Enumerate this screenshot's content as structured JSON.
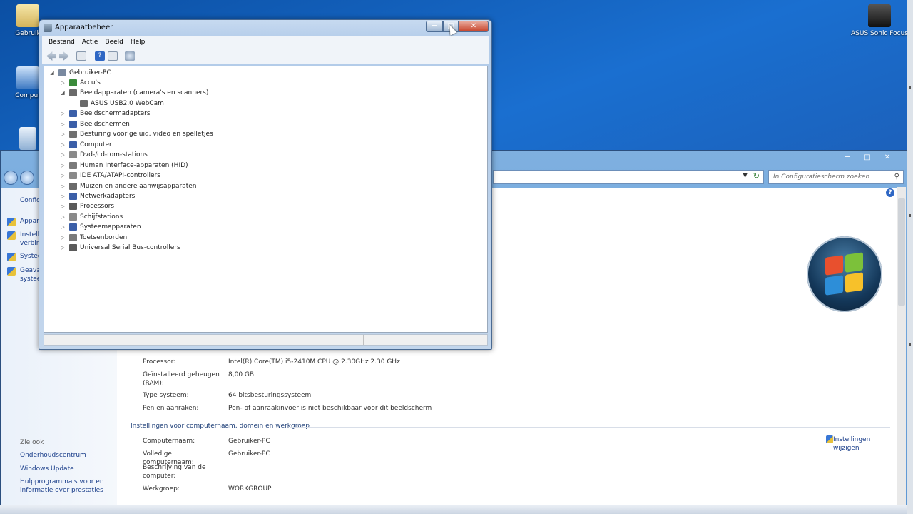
{
  "desktop": {
    "icons": [
      {
        "label": "Gebruik",
        "icon": "user-folder-icon"
      },
      {
        "label": "Comput",
        "icon": "computer-icon"
      },
      {
        "label": "",
        "icon": "recycle-bin-icon"
      },
      {
        "label": "ASUS Sonic Focus",
        "icon": "asus-sonic-focus-icon"
      }
    ]
  },
  "control_panel": {
    "search_placeholder": "In Configuratiescherm zoeken",
    "left_title": "Config",
    "left_links": [
      {
        "label": "Appara"
      },
      {
        "label": "Instelli",
        "label2": "verbin"
      },
      {
        "label": "Systee"
      },
      {
        "label": "Geava",
        "label2": "systee"
      }
    ],
    "see_also": {
      "title": "Zie ook",
      "links": [
        "Onderhoudscentrum",
        "Windows Update",
        "Hulpprogramma's voor en",
        "informatie over prestaties"
      ]
    },
    "system": {
      "processor_label": "Processor:",
      "processor_value": "Intel(R) Core(TM) i5-2410M CPU @ 2.30GHz   2.30 GHz",
      "ram_label": "Geïnstalleerd geheugen",
      "ram_label2": "(RAM):",
      "ram_value": "8,00 GB",
      "type_label": "Type systeem:",
      "type_value": "64 bitsbesturingssysteem",
      "pen_label": "Pen en aanraken:",
      "pen_value": "Pen- of aanraakinvoer is niet beschikbaar voor dit beeldscherm"
    },
    "computer_section": {
      "title": "Instellingen voor computernaam, domein en werkgroep",
      "name_label": "Computernaam:",
      "name_value": "Gebruiker-PC",
      "full_label": "Volledige computernaam:",
      "full_value": "Gebruiker-PC",
      "desc_label": "Beschrijving van de",
      "desc_label2": "computer:",
      "wg_label": "Werkgroep:",
      "wg_value": "WORKGROUP",
      "change_label": "Instellingen",
      "change_label2": "wijzigen"
    }
  },
  "device_manager": {
    "title": "Apparaatbeheer",
    "menu": [
      "Bestand",
      "Actie",
      "Beeld",
      "Help"
    ],
    "root": "Gebruiker-PC",
    "nodes": [
      {
        "label": "Accu's",
        "expanded": false,
        "color": "#3a8a3a"
      },
      {
        "label": "Beeldapparaten (camera's en scanners)",
        "expanded": true,
        "color": "#6a6a6a"
      },
      {
        "label": "ASUS USB2.0 WebCam",
        "child": true,
        "color": "#6a6a6a"
      },
      {
        "label": "Beeldschermadapters",
        "expanded": false,
        "color": "#3b5fa8"
      },
      {
        "label": "Beeldschermen",
        "expanded": false,
        "color": "#3b5fa8"
      },
      {
        "label": "Besturing voor geluid, video en spelletjes",
        "expanded": false,
        "color": "#707070"
      },
      {
        "label": "Computer",
        "expanded": false,
        "color": "#3b5fa8"
      },
      {
        "label": "Dvd-/cd-rom-stations",
        "expanded": false,
        "color": "#8a8a8a"
      },
      {
        "label": "Human Interface-apparaten (HID)",
        "expanded": false,
        "color": "#7a7a7a"
      },
      {
        "label": "IDE ATA/ATAPI-controllers",
        "expanded": false,
        "color": "#8a8a8a"
      },
      {
        "label": "Muizen en andere aanwijsapparaten",
        "expanded": false,
        "color": "#6a6a6a"
      },
      {
        "label": "Netwerkadapters",
        "expanded": false,
        "color": "#3b5fa8"
      },
      {
        "label": "Processors",
        "expanded": false,
        "color": "#5a5a5a"
      },
      {
        "label": "Schijfstations",
        "expanded": false,
        "color": "#8a8a8a"
      },
      {
        "label": "Systeemapparaten",
        "expanded": false,
        "color": "#3b5fa8"
      },
      {
        "label": "Toetsenborden",
        "expanded": false,
        "color": "#7a7a7a"
      },
      {
        "label": "Universal Serial Bus-controllers",
        "expanded": false,
        "color": "#5a5a5a"
      }
    ]
  },
  "colors": {
    "desktop": "#1a6fd0",
    "link": "#1a3e8a",
    "close_button": "#c7432a"
  }
}
